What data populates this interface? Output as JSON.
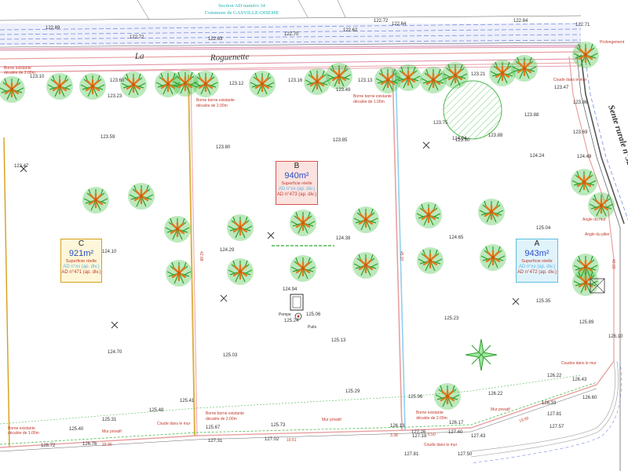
{
  "header": {
    "section_line": "Section AD numéro 34",
    "commune_line": "Commune de GASVILLE-OISEME"
  },
  "streets": {
    "north_word1": "La",
    "north_word2": "Roguenette",
    "east": "Sente rurale n°32"
  },
  "lots": [
    {
      "letter": "C",
      "area": "921m²",
      "superficie": "Superficie réelle",
      "ref1": "AD n°xx (ap. div.)",
      "ref2": "AD n°471 (ap. div.)",
      "border": "#d4a017",
      "bg": "#fdf6d8",
      "area_color": "#2b4ec4"
    },
    {
      "letter": "B",
      "area": "940m²",
      "superficie": "Superficie réelle",
      "ref1": "AD n°xx (ap. div.)",
      "ref2": "AD n°473 (ap. div.)",
      "border": "#d9534f",
      "bg": "#fbe3e0",
      "area_color": "#2b4ec4"
    },
    {
      "letter": "A",
      "area": "943m²",
      "superficie": "Superficie réelle",
      "ref1": "AD n°xx (ap. div.)",
      "ref2": "AD n°472 (ap. div.)",
      "border": "#5bc0de",
      "bg": "#e0f3fb",
      "area_color": "#2b4ec4"
    }
  ],
  "notes": {
    "borne_1": "Borne borne existante",
    "borne_1b": "décalée de 2.00m",
    "borne_2": "Borne existante",
    "borne_2b": "décalée de 2.00m",
    "borne_3": "Borne borne existante",
    "borne_3b": "décalée de 1.00m",
    "borne_4": "Borne existante",
    "borne_4b": "décalée de 1.00m",
    "borne_5": "Borne borne existante",
    "borne_5b": "décalée de 2.00m",
    "borne_6": "Borne existante",
    "borne_6b": "décalée de 2.00m",
    "pompe": "Pompe",
    "puits": "Puits",
    "coude_1": "Coude dans le mur",
    "coude_2": "Coude dans le mur",
    "coude_3": "Coude dans le mur",
    "angle_1": "Angle du mur",
    "angle_2": "Angle du pilier",
    "mur_1": "Mur privatif",
    "mur_2": "Mur privatif",
    "mur_3": "Mur privatif",
    "prolongement": "Prolongement",
    "coudes_mur": "Coudes dans le mur"
  },
  "elevations": {
    "e1": "122.89",
    "e2": "122.72",
    "e3": "122.63",
    "e4": "122.70",
    "e5": "122.62",
    "e6": "122.72",
    "e7": "122.64",
    "e8": "122.84",
    "e9": "122.71",
    "e10": "123.10",
    "e11": "123.60",
    "e12": "123.23",
    "e13": "123.12",
    "e14": "123.16",
    "e15": "123.13",
    "e16": "123.49",
    "e17": "123.21",
    "e18": "123.47",
    "e19": "123.75",
    "e20": "123.88",
    "e21": "123.90",
    "e22": "123.88",
    "e23": "123.69",
    "e24": "123.47",
    "e25": "123.59",
    "e26": "123.80",
    "e27": "123.85",
    "e28": "124.04",
    "e29": "124.24",
    "e30": "124.48",
    "e31": "124.10",
    "e32": "124.29",
    "e33": "124.38",
    "e34": "124.65",
    "e35": "125.04",
    "e36": "125.35",
    "e37": "125.23",
    "e38": "124.94",
    "e39": "125.06",
    "e40": "125.24",
    "e41": "125.13",
    "e42": "124.70",
    "e43": "125.03",
    "e44": "125.48",
    "e45": "125.41",
    "e46": "125.31",
    "e47": "125.40",
    "e48": "125.67",
    "e49": "125.73",
    "e50": "125.96",
    "e51": "126.13",
    "e52": "126.17",
    "e53": "126.22",
    "e54": "126.33",
    "e55": "126.22",
    "e56": "126.43",
    "e57": "126.72",
    "e58": "126.76",
    "e59": "127.31",
    "e60": "127.02",
    "e61": "127.18",
    "e62": "127.26",
    "e63": "127.40",
    "e64": "127.43",
    "e65": "127.50",
    "e66": "127.57",
    "e67": "127.81",
    "e68": "127.81",
    "e69": "123.86",
    "e70": "126.60",
    "e71": "125.89",
    "e72": "126.10",
    "e73": "125.29"
  },
  "dims": {
    "d1": "22.30",
    "d2": "19.51",
    "d3": "3.38",
    "d4": "6.50",
    "d5": "19.50",
    "d6": "42.68",
    "d7": "45.97",
    "d8": "40.00"
  },
  "colors": {
    "lot_c": "#d4a017",
    "lot_b": "#d9534f",
    "lot_a": "#5bc0de",
    "tree_foliage": "#2e9e2e",
    "tree_trunk": "#e07a1f",
    "boundary": "#e8a0a0"
  }
}
